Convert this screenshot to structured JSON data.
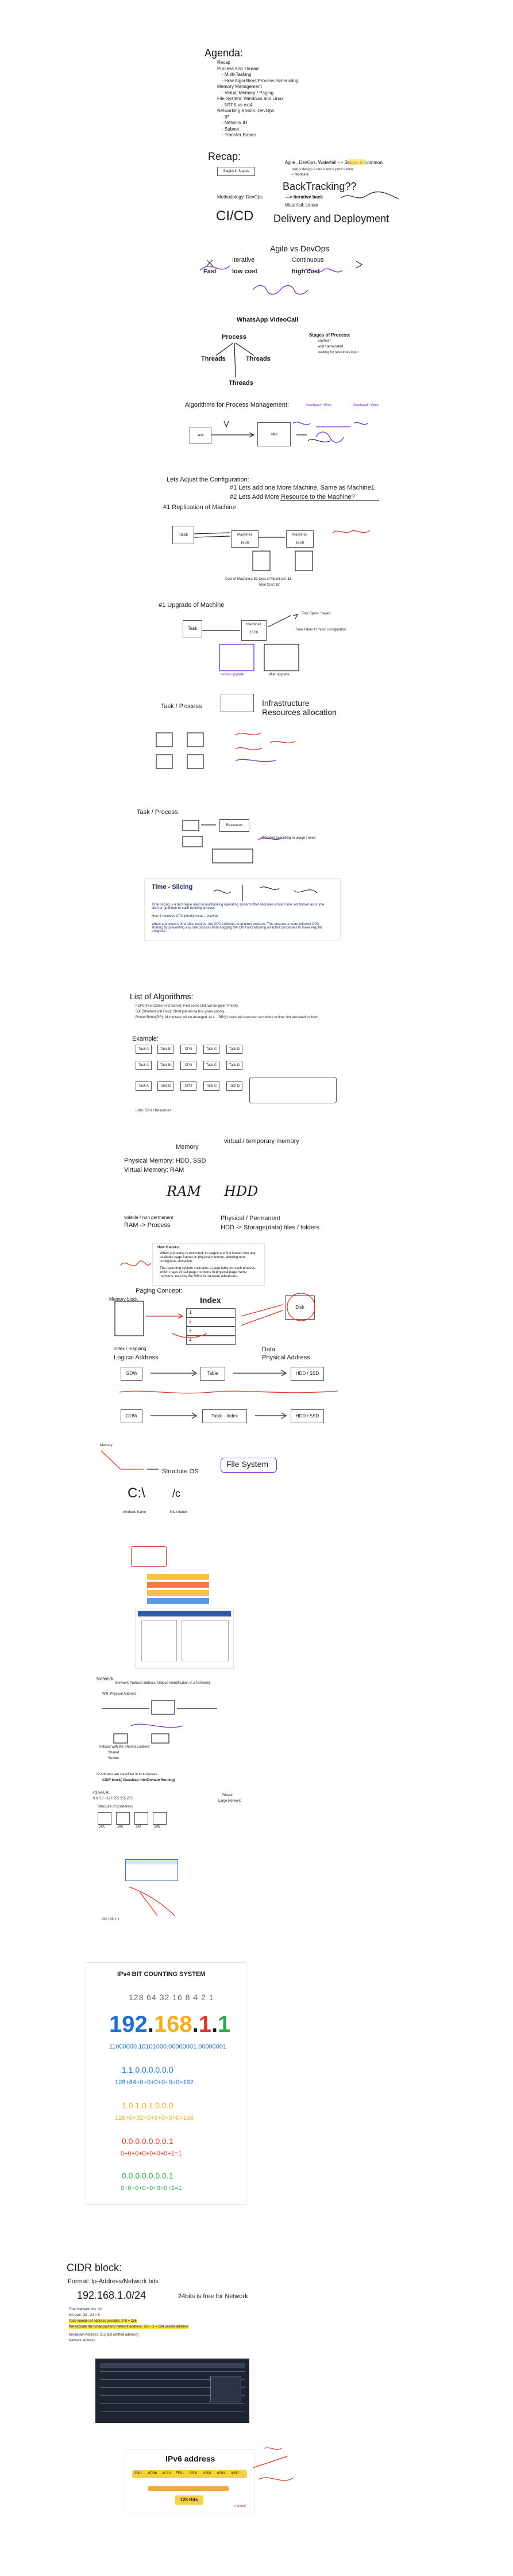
{
  "agenda": {
    "title": "Agenda:",
    "items": [
      "Recap",
      "Process and Thread",
      "- Multi-Tasking",
      "- How Algorithms/Process Scheduling",
      "Memory Management",
      "- Virtual Memory / Paging",
      "File System: Windows and Linux",
      "- NTFS vs ext4",
      "Networking Basics: DevOps",
      "- IP",
      "- Network ID",
      "- Subnet",
      "- Transfer Basics"
    ]
  },
  "recap": {
    "title": "Recap:",
    "box_label": "Stages in Stages",
    "agile_line": "Agile , DevOps, Waterfall --> Stages in common.",
    "stages_line": "plan > design > dev > test > prod > mon",
    "feedback": "> feedback",
    "backtracking": "BackTracking??",
    "methodology": "Methodology: DevOps",
    "iterative_back": "---> iterative back",
    "waterfall": "Waterfall: Linear",
    "cicd": "CI/CD",
    "delivery": "Delivery and Deployment"
  },
  "agile_devops": {
    "title": "Agile vs DevOps",
    "iterative": "Iterative",
    "continuous": "Continuous",
    "slow_cost": "low cost",
    "high_cost": "high cost",
    "fast": "Fast"
  },
  "whatsapp": {
    "title": "WhatsApp VideoCall",
    "process": "Process",
    "threads_left": "Threads",
    "threads_right": "Threads",
    "threads_bottom": "Threads",
    "stages_title": "Stages of Process:",
    "stages": [
      "started /",
      "end / terminated",
      "waiting for resources input"
    ]
  },
  "algorithms_process": {
    "title": "Algorithms for Process Management:",
    "overhead_left": "Overhead / Work",
    "overhead_right": "Overhead / Work",
    "task_label": "task",
    "algo_label": "algo",
    "config_title": "Lets Adjust the Configuration:",
    "config_line1": "#1 Lets add one More Machine, Same as Machine1",
    "config_line2": "#2 Lets Add More Resource to the Machine?",
    "replication": "#1 Replication of Machine",
    "task": "Task",
    "machine1": "Machine1",
    "machine2": "Machine2",
    "size": "16Gb",
    "cost_line": "Cost of Machine1: $1     Cost of Machine2: $1",
    "total": "Total Cost: $2",
    "upgrade": "#1 Upgrade of Machine",
    "time_spent": "Time Spent: Saved",
    "time_taken": "Time Taken In mins: configuration",
    "before": "before upgrade",
    "after": "after upgrade"
  },
  "task_process": {
    "title": "Task / Process",
    "infra": "Infrastructure",
    "resources": "Resources allocation",
    "title2": "Task / Process",
    "resources_box": "Resources",
    "allocated": "Allocated according to usage / need"
  },
  "time_slicing": {
    "title": "Time - Slicing",
    "para1": "Time slicing is a technique used in multitasking operating systems that allocates a fixed time slot known as a time slice or quantum to each running process.",
    "para2": "How it resolves CPU priority issue: resolved",
    "para3": "When a process's time slice expires, the CPU switches to another process. This ensures a more efficient CPU sharing by preventing any one process from hogging the CPU and allowing all active processes to make regular progress."
  },
  "list_algorithms": {
    "title": "List of Algorithms:",
    "items": [
      "FCFS(First Come First Serve): First come task will be given Priority.",
      "SJF(Shortest Job First): Short job will be first given priority.",
      "Round Robin(RR): All the task will be arranged, ALL... RR(#) tasks will executed according to time slot allocated to them."
    ],
    "example": "Example:",
    "units": "units: CPU / Resources",
    "proc_boxes": [
      "Task A",
      "Task B",
      "CPU",
      "Task C",
      "Task D"
    ]
  },
  "memory": {
    "title": "Memory",
    "virtual_title": "virtual / temporary memory",
    "physical": "Physical Memory: HDD, SSD",
    "virtual": "Virtual Memory: RAM",
    "ram_hand": "RAM",
    "hdd_hand": "HDD",
    "volatile": "volatile / non permanent",
    "ram_process": "RAM -> Process",
    "physical_perm": "Physical / Permanent",
    "hdd_storage": "HDD -> Storage(data) files / folders",
    "paging_box_title": "How it works:",
    "paging_bullets": [
      "When a process is executed, its pages are first loaded into any available page frames in physical memory, allowing non-contiguous allocation.",
      "The operating system maintains a page table for each process, which maps virtual page numbers to physical page frame numbers, used by the MMU to translate addresses."
    ],
    "paging": "Paging Concept:",
    "memory_block": "Memory block",
    "disk": "Disk",
    "index_mapping": "index / mapping",
    "logical": "Logical Address",
    "data": "Data",
    "physical_addr": "Physical Address",
    "gow": "GOW",
    "table": "Table",
    "hdd_ssd": "HDD / SSD",
    "table_index": "Table - Index",
    "index_hand": "Index",
    "rows": [
      "1",
      "2",
      "3",
      "4"
    ]
  },
  "filesystem": {
    "memory": "Memory",
    "structure": "Structure OS",
    "file_system": "File System",
    "c_drive": "C:\\",
    "slash_c": "/c",
    "windows": "windows frame",
    "linux": "linux frame"
  },
  "network": {
    "title": "Network",
    "subtitle": "(Network Protocol address: Unique Identification in a Network)",
    "wifi": "Wifi: Physical Address",
    "hotspot": "Hotspot with the Shared Enabled",
    "shared": "Shared",
    "sender": "Sender",
    "ip_classes": "IP Address are classified in to 4 classes",
    "cidr_line": "CIDR block( Classless InterDomain Routing)",
    "class_a": "Class A:",
    "range_a": "0.0.0.0 - 127.255.255.255",
    "structure": "Structure of Ip Address",
    "private": "Private",
    "large": "Large Network",
    "octets": [
      "255",
      "255",
      "255",
      "255"
    ],
    "ip_example": "192.168.1.1"
  },
  "ipv4": {
    "title": "IPv4 BIT COUNTING SYSTEM",
    "bits": "128 64 32 16 8 4 2 1",
    "ip": [
      "192",
      ".",
      "168",
      ".",
      "1",
      ".",
      "1"
    ],
    "binary": "11000000.10101000.00000001.00000001",
    "row1": "1.1.0.0.0.0.0.0",
    "row1_sum": "128+64+0+0+0+0+0+0=192",
    "row2": "1.0.1.0.1.0.0.0",
    "row2_sum": "128+0+32+0+8+0+0+0=168",
    "row3": "0.0.0.0.0.0.0.1",
    "row3_sum": "0+0+0+0+0+0+0+1=1",
    "row4": "0.0.0.0.0.0.0.1",
    "row4_sum": "0+0+0+0+0+0+0+1=1"
  },
  "cidr": {
    "title": "CIDR block:",
    "format": "Format: Ip-Address/Network bits",
    "example": "192.168.1.0/24",
    "free": "24bits is free for Network",
    "lines": [
      "Total Network bits: 32",
      "left over: 32 - 24 = 8",
      "Total number of address possible: 2^8 = 256",
      "We exclude the broadcast and network address: 256 - 2 = 254 usable address",
      "Broadcast Address: 255(last allotted address)",
      "Network address:"
    ]
  },
  "ipv6": {
    "title": "IPv6 address",
    "groups": [
      "2001",
      "0DB8",
      "AC10",
      "FE01",
      "0000",
      "0000",
      "0000",
      "0000"
    ],
    "label": "128 Bits",
    "footer": "mutotal"
  },
  "colors": {
    "ink": "#1a1a1a",
    "red": "#d8362a",
    "purple": "#6a2bd1",
    "ipv4_blue": "#1f6fd1",
    "ipv4_yellow": "#f2b01e",
    "ipv4_red": "#d93a2b",
    "ipv4_green": "#2aa84a"
  }
}
